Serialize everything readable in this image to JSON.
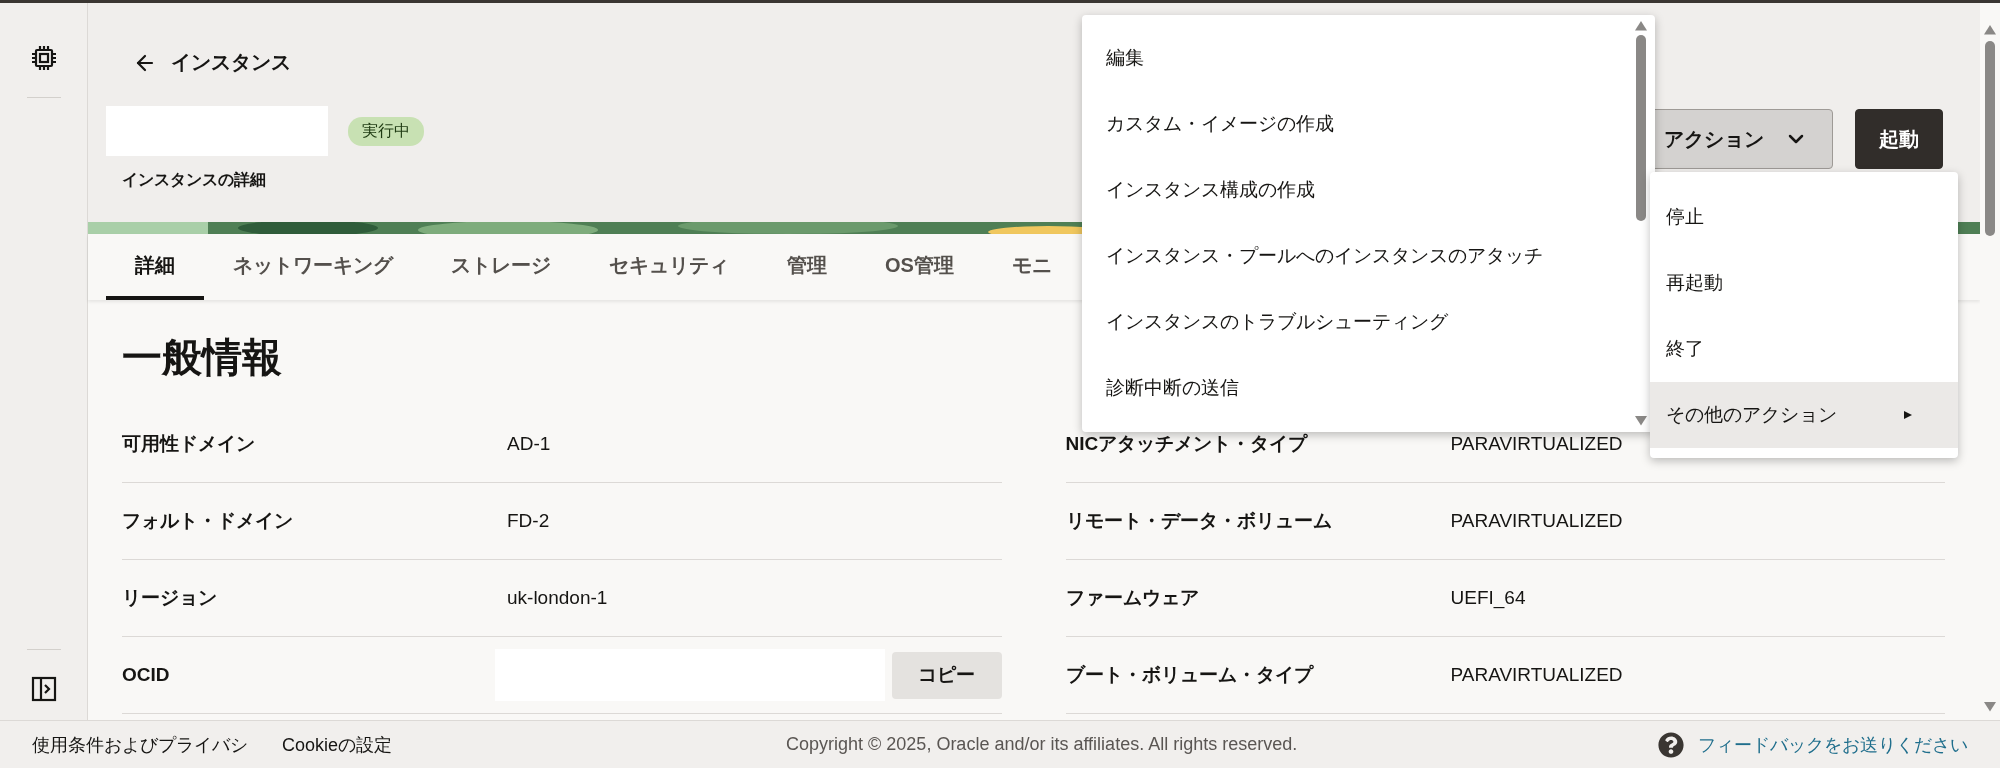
{
  "back_link": {
    "label": "インスタンス"
  },
  "status_badge": "実行中",
  "subtitle": "インスタンスの詳細",
  "header_buttons": [
    {
      "label": "アクション",
      "kind": "dropdown"
    },
    {
      "label": "起動",
      "kind": "primary"
    }
  ],
  "tabs": [
    {
      "label": "詳細",
      "selected": true
    },
    {
      "label": "ネットワーキング",
      "selected": false
    },
    {
      "label": "ストレージ",
      "selected": false
    },
    {
      "label": "セキュリティ",
      "selected": false
    },
    {
      "label": "管理",
      "selected": false
    },
    {
      "label": "OS管理",
      "selected": false
    },
    {
      "label": "モニ",
      "selected": false
    }
  ],
  "general_info": {
    "title": "一般情報",
    "rows": [
      {
        "label": "可用性ドメイン",
        "kind": "text",
        "value": "AD-1"
      },
      {
        "label": "フォルト・ドメイン",
        "kind": "text",
        "value": "FD-2"
      },
      {
        "label": "リージョン",
        "kind": "text",
        "value": "uk-london-1"
      },
      {
        "label": "OCID",
        "kind": "copy",
        "button": "コピー"
      }
    ]
  },
  "launch_options": {
    "rows": [
      {
        "label": "NICアタッチメント・タイプ",
        "value": "PARAVIRTUALIZED"
      },
      {
        "label": "リモート・データ・ボリューム",
        "value": "PARAVIRTUALIZED"
      },
      {
        "label": "ファームウェア",
        "value": "UEFI_64"
      },
      {
        "label": "ブート・ボリューム・タイプ",
        "value": "PARAVIRTUALIZED"
      }
    ]
  },
  "actions_menu": {
    "items": [
      {
        "label": "編集"
      },
      {
        "label": "カスタム・イメージの作成"
      },
      {
        "label": "インスタンス構成の作成"
      },
      {
        "label": "インスタンス・プールへのインスタンスのアタッチ"
      },
      {
        "label": "インスタンスのトラブルシューティング"
      },
      {
        "label": "診断中断の送信"
      }
    ]
  },
  "submenu": {
    "items": [
      {
        "label": "停止",
        "kind": "action",
        "highlighted": false
      },
      {
        "label": "再起動",
        "kind": "action",
        "highlighted": false
      },
      {
        "label": "終了",
        "kind": "action",
        "highlighted": false
      },
      {
        "label": "その他のアクション",
        "kind": "submenu",
        "highlighted": true
      }
    ]
  },
  "footer": {
    "links": [
      "使用条件およびプライバシ",
      "Cookieの設定"
    ],
    "copyright": "Copyright © 2025, Oracle and/or its affiliates. All rights reserved.",
    "feedback": "フィードバックをお送りください"
  }
}
